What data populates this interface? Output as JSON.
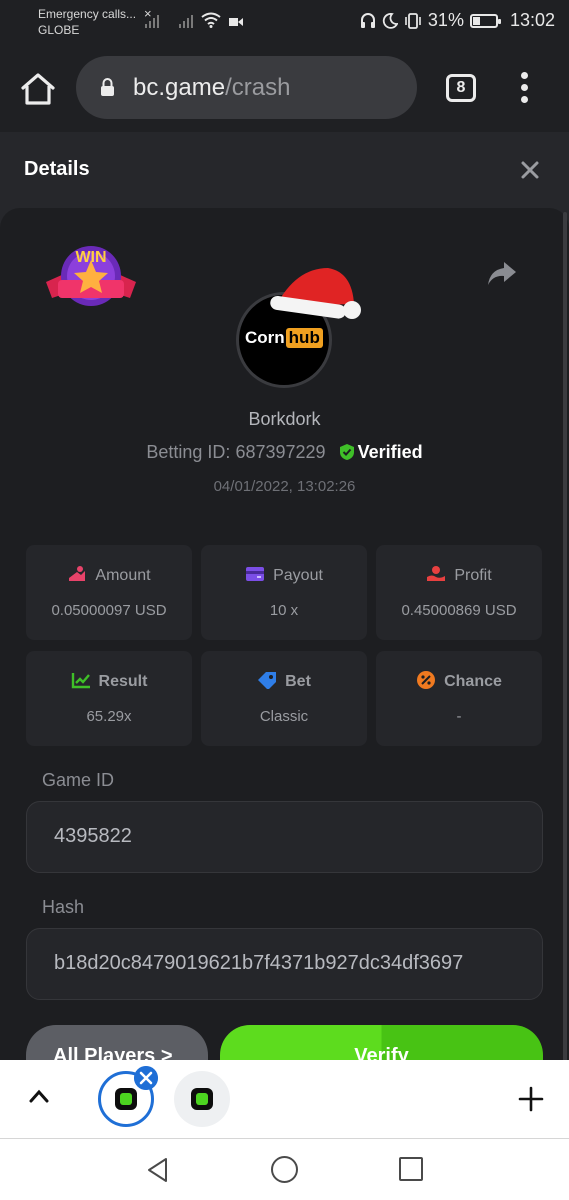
{
  "status_bar": {
    "carrier_line1": "Emergency calls...",
    "carrier_line2": "GLOBE",
    "battery_percent": "31%",
    "battery_level": 0.31,
    "time": "13:02"
  },
  "browser": {
    "url_host": "bc.game",
    "url_path": "/crash",
    "tab_count": "8"
  },
  "details": {
    "title": "Details",
    "username": "Borkdork",
    "betting_id_label": "Betting ID:",
    "betting_id": "687397229",
    "verified_label": "Verified",
    "timestamp": "04/01/2022, 13:02:26",
    "avatar_text_a": "Corn",
    "avatar_text_b": "hub",
    "win_badge_text": "WIN"
  },
  "stats": [
    {
      "label": "Amount",
      "value": "0.05000097 USD",
      "icon": "amount-icon",
      "color": "#e8436a"
    },
    {
      "label": "Payout",
      "value": "10 x",
      "icon": "payout-icon",
      "color": "#7b4ee6"
    },
    {
      "label": "Profit",
      "value": "0.45000869 USD",
      "icon": "profit-icon",
      "color": "#e84040"
    },
    {
      "label": "Result",
      "value": "65.29x",
      "icon": "result-icon",
      "color": "#3fbf28"
    },
    {
      "label": "Bet",
      "value": "Classic",
      "icon": "bet-icon",
      "color": "#2f7ee8"
    },
    {
      "label": "Chance",
      "value": "-",
      "icon": "chance-icon",
      "color": "#f07a20"
    }
  ],
  "game": {
    "game_id_label": "Game ID",
    "game_id": "4395822",
    "hash_label": "Hash",
    "hash": "b18d20c8479019621b7f4371b927dc34df3697"
  },
  "actions": {
    "all_players_label": "All Players >",
    "verify_label": "Verify"
  },
  "colors": {
    "accent_green": "#5ddc1e",
    "verified_green": "#3fbf28",
    "tab_active_blue": "#1f6fd6"
  }
}
